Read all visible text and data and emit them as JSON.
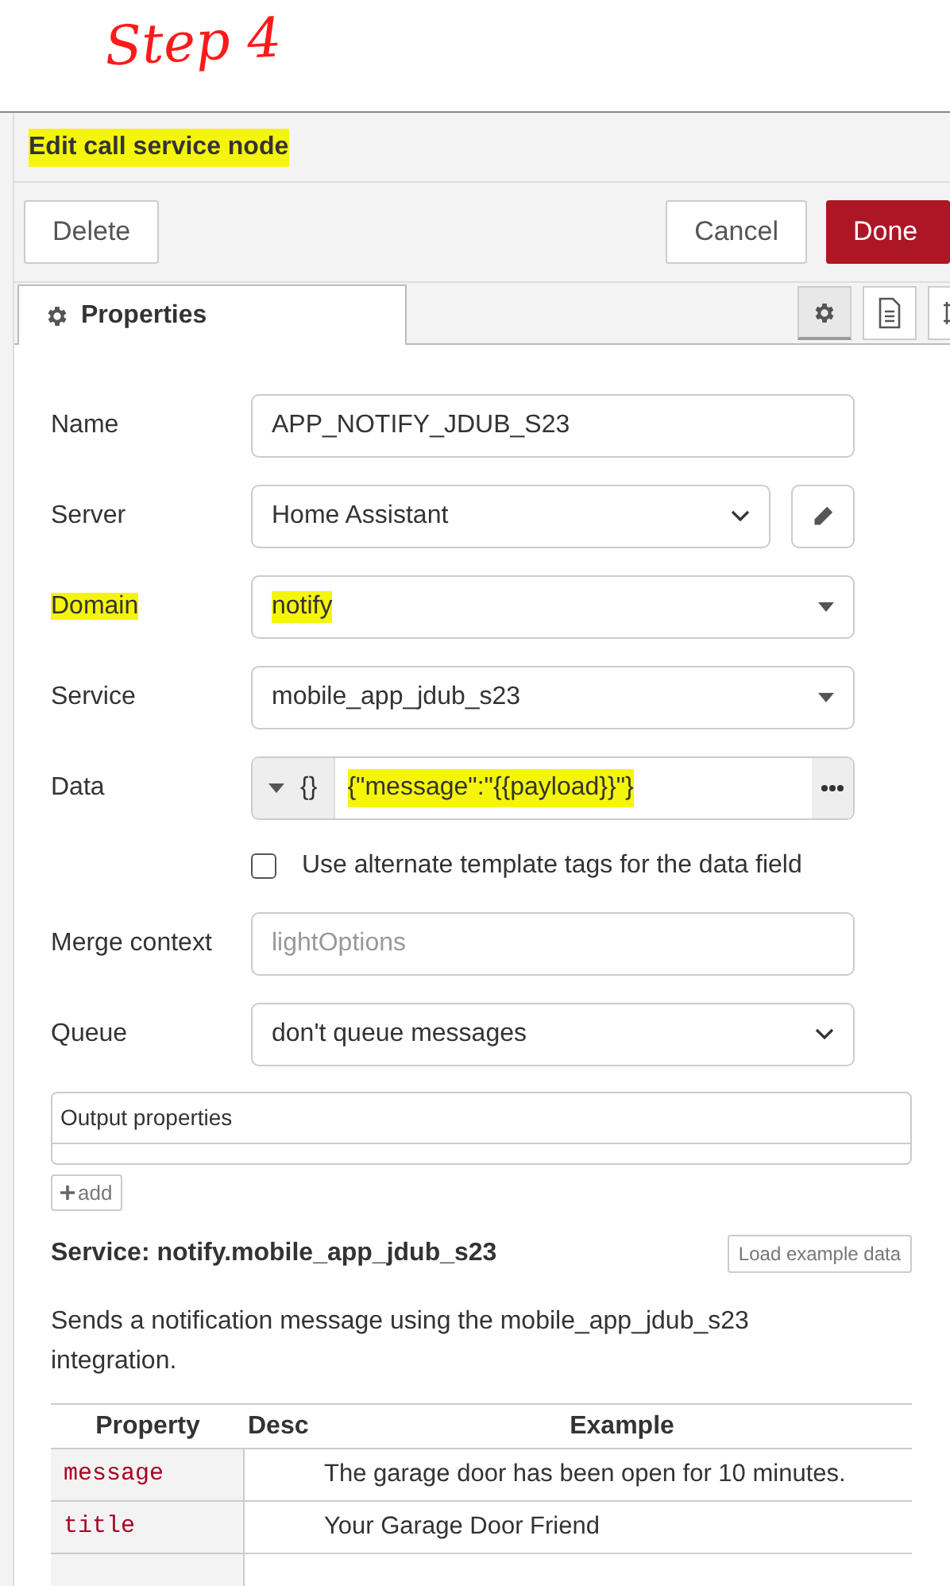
{
  "annotation": {
    "text": "Step 4"
  },
  "dialog": {
    "title": "Edit call service node",
    "title_highlighted": true
  },
  "buttons": [
    {
      "label": "Delete",
      "kind": "plain"
    },
    {
      "label": "Cancel",
      "kind": "plain"
    },
    {
      "label": "Done",
      "kind": "primary"
    }
  ],
  "tabs": [
    {
      "label": "Properties",
      "selected": true
    }
  ],
  "side_tabs": [
    {
      "selected": true
    },
    {
      "selected": false
    },
    {
      "selected": false
    }
  ],
  "form": [
    {
      "kind": "text",
      "label": "Name",
      "value": "APP_NOTIFY_JDUB_S23"
    },
    {
      "kind": "select-edit",
      "label": "Server",
      "value": "Home Assistant"
    },
    {
      "kind": "combo",
      "label": "Domain",
      "value": "notify",
      "label_highlighted": true,
      "value_highlighted": true
    },
    {
      "kind": "combo",
      "label": "Service",
      "value": "mobile_app_jdub_s23"
    },
    {
      "kind": "typed",
      "label": "Data",
      "type_icon": "{}",
      "value": "{\"message\":\"{{payload}}\"}",
      "value_highlighted": true
    },
    {
      "kind": "checkbox",
      "label": "Use alternate template tags for the data field",
      "checked": false
    },
    {
      "kind": "text",
      "label": "Merge context",
      "placeholder": "lightOptions"
    },
    {
      "kind": "select",
      "label": "Queue",
      "value": "don't queue messages"
    }
  ],
  "output": {
    "header": "Output properties",
    "add_button": "add"
  },
  "service": {
    "title": "Service: notify.mobile_app_jdub_s23",
    "load_button": "Load example data",
    "description": "Sends a notification message using the mobile_app_jdub_s23 integration.",
    "columns": [
      "Property",
      "Desc",
      "Example"
    ],
    "rows": [
      {
        "property": "message",
        "desc": "",
        "example": "The garage door has been open for 10 minutes."
      },
      {
        "property": "title",
        "desc": "",
        "example": "Your Garage Door Friend"
      }
    ]
  }
}
